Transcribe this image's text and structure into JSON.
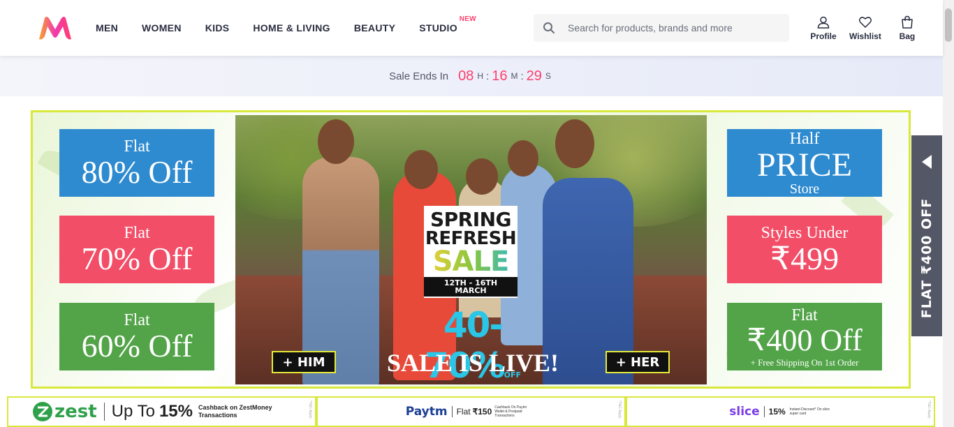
{
  "header": {
    "logo_alt": "Myntra",
    "nav": [
      {
        "label": "MEN"
      },
      {
        "label": "WOMEN"
      },
      {
        "label": "KIDS"
      },
      {
        "label": "HOME & LIVING"
      },
      {
        "label": "BEAUTY"
      },
      {
        "label": "STUDIO",
        "badge": "NEW"
      }
    ],
    "search": {
      "placeholder": "Search for products, brands and more",
      "value": ""
    },
    "actions": [
      {
        "label": "Profile",
        "icon": "profile-icon"
      },
      {
        "label": "Wishlist",
        "icon": "heart-icon"
      },
      {
        "label": "Bag",
        "icon": "bag-icon"
      }
    ]
  },
  "sale_timer": {
    "label": "Sale Ends In",
    "hours": "08",
    "hours_unit": "H",
    "minutes": "16",
    "minutes_unit": "M",
    "seconds": "29",
    "seconds_unit": "S",
    "separator": ":"
  },
  "banner": {
    "left_tiles": [
      {
        "line1": "Flat",
        "line2": "80% Off",
        "color": "#2e8bd0"
      },
      {
        "line1": "Flat",
        "line2": "70% Off",
        "color": "#f24e67"
      },
      {
        "line1": "Flat",
        "line2": "60% Off",
        "color": "#53a449"
      }
    ],
    "right_tiles": [
      {
        "line1": "Half",
        "line2": "PRICE",
        "line3": "Store",
        "color": "#2e8bd0"
      },
      {
        "line1": "Styles Under",
        "line2": "₹499",
        "color": "#f24e67"
      },
      {
        "line1": "Flat",
        "line2": "₹400 Off",
        "line3": "+ Free Shipping On 1st Order",
        "color": "#53a449"
      }
    ],
    "campaign": {
      "line1": "SPRING",
      "line2": "REFRESH",
      "line3": "SALE",
      "dates": "12TH - 16TH MARCH",
      "discount": "40-70%",
      "discount_suffix": "OFF",
      "headline": "SALE IS LIVE!",
      "cta_left": "+ HIM",
      "cta_right": "+ HER"
    }
  },
  "side_tab": {
    "label": "FLAT ₹400 OFF"
  },
  "offers": [
    {
      "brand": "zest",
      "text": "Up To",
      "amount": "15%",
      "detail": "Cashback on ZestMoney Transactions",
      "note": "*T&C Apply",
      "brand_color": "#2fa14a"
    },
    {
      "brand": "Paytm",
      "text": "Flat",
      "amount": "₹150",
      "detail": "Cashback On Paytm Wallet & Postpaid Transactions",
      "note": "*T&C Apply",
      "brand_color": "#1c3f94"
    },
    {
      "brand": "slice",
      "text": "",
      "amount": "15%",
      "detail": "Instant Discount* On slice super card",
      "note": "*T&C Apply",
      "brand_color": "#7b3fe4"
    }
  ]
}
